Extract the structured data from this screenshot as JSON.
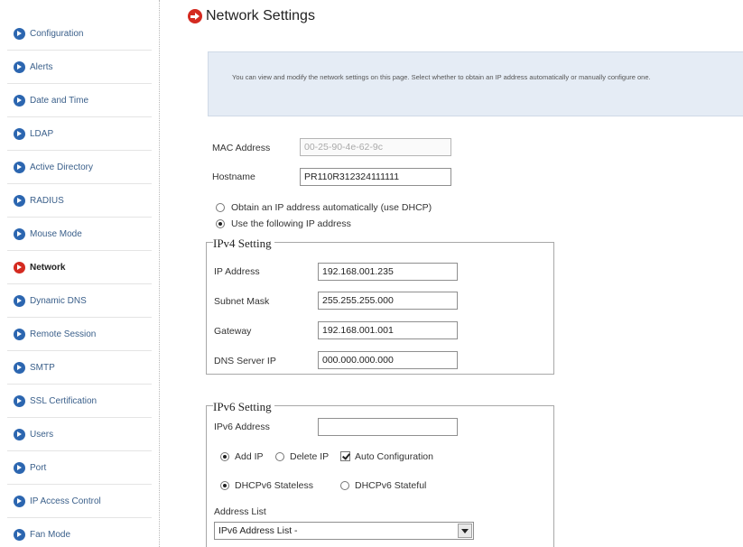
{
  "colors": {
    "nav_icon": "#2c66b0",
    "nav_icon_active": "#d42a20",
    "info_bg": "#e5ecf5"
  },
  "sidebar": {
    "items": [
      {
        "label": "Configuration",
        "icon": "arrow-circle-icon"
      },
      {
        "label": "Alerts",
        "icon": "arrow-circle-icon"
      },
      {
        "label": "Date and Time",
        "icon": "arrow-circle-icon"
      },
      {
        "label": "LDAP",
        "icon": "arrow-circle-icon"
      },
      {
        "label": "Active Directory",
        "icon": "arrow-circle-icon"
      },
      {
        "label": "RADIUS",
        "icon": "arrow-circle-icon"
      },
      {
        "label": "Mouse Mode",
        "icon": "arrow-circle-icon"
      },
      {
        "label": "Network",
        "icon": "arrow-circle-icon",
        "active": true
      },
      {
        "label": "Dynamic DNS",
        "icon": "arrow-circle-icon"
      },
      {
        "label": "Remote Session",
        "icon": "arrow-circle-icon"
      },
      {
        "label": "SMTP",
        "icon": "arrow-circle-icon"
      },
      {
        "label": "SSL Certification",
        "icon": "arrow-circle-icon"
      },
      {
        "label": "Users",
        "icon": "arrow-circle-icon"
      },
      {
        "label": "Port",
        "icon": "arrow-circle-icon"
      },
      {
        "label": "IP Access Control",
        "icon": "arrow-circle-icon"
      },
      {
        "label": "Fan Mode",
        "icon": "arrow-circle-icon"
      }
    ]
  },
  "header": {
    "title": "Network Settings"
  },
  "info": {
    "text": "You can view and modify the network settings on this page. Select whether to obtain an IP address automatically or manually configure one."
  },
  "form": {
    "mac_label": "MAC Address",
    "mac_value": "00-25-90-4e-62-9c",
    "hostname_label": "Hostname",
    "hostname_value": "PR110R312324111111",
    "ip_mode": {
      "dhcp_label": "Obtain an IP address automatically (use DHCP)",
      "static_label": "Use the following IP address",
      "selected": "static"
    }
  },
  "ipv4": {
    "legend": "IPv4 Setting",
    "ip_label": "IP Address",
    "ip_value": "192.168.001.235",
    "subnet_label": "Subnet Mask",
    "subnet_value": "255.255.255.000",
    "gateway_label": "Gateway",
    "gateway_value": "192.168.001.001",
    "dns_label": "DNS Server IP",
    "dns_value": "000.000.000.000"
  },
  "ipv6": {
    "legend": "IPv6 Setting",
    "address_label": "IPv6 Address",
    "address_value": "",
    "add_label": "Add IP",
    "delete_label": "Delete IP",
    "auto_config_label": "Auto Configuration",
    "auto_config_checked": true,
    "ip_action_selected": "add",
    "stateless_label": "DHCPv6 Stateless",
    "stateful_label": "DHCPv6 Stateful",
    "dhcp_mode_selected": "stateless",
    "address_list_label": "Address List",
    "address_list_selected": "IPv6 Address List -"
  }
}
